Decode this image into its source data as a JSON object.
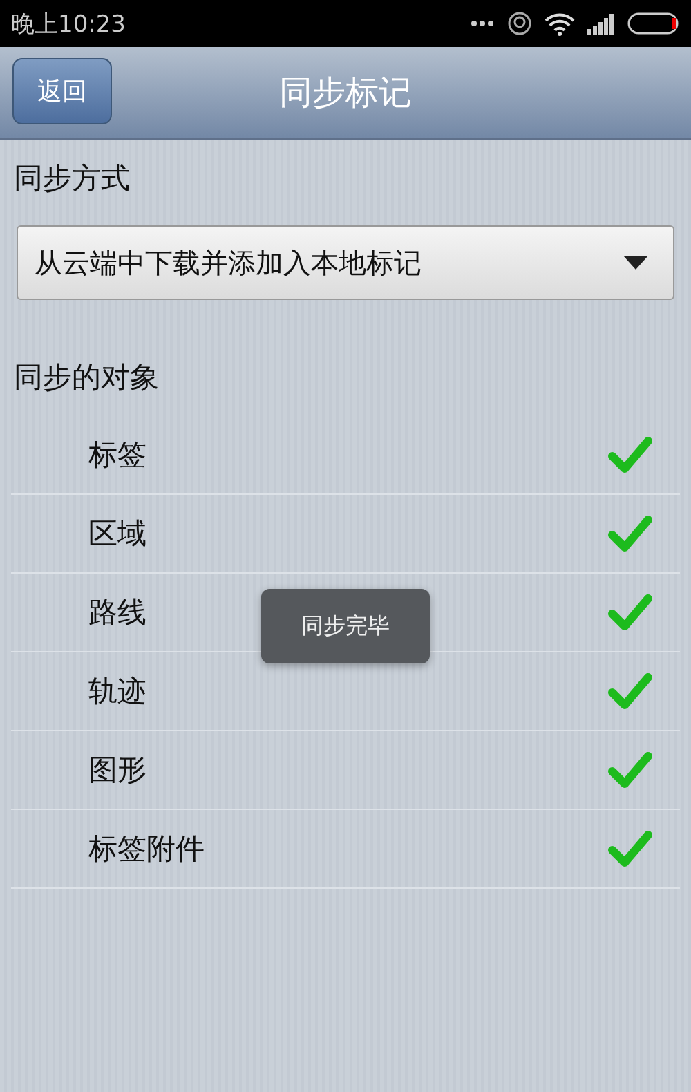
{
  "status_bar": {
    "time": "晚上10:23"
  },
  "header": {
    "back_button": "返回",
    "title": "同步标记"
  },
  "sync_mode": {
    "label": "同步方式",
    "value": "从云端中下载并添加入本地标记"
  },
  "objects": {
    "label": "同步的对象",
    "items": [
      {
        "label": "标签",
        "checked": true
      },
      {
        "label": "区域",
        "checked": true
      },
      {
        "label": "路线",
        "checked": true
      },
      {
        "label": "轨迹",
        "checked": true
      },
      {
        "label": "图形",
        "checked": true
      },
      {
        "label": "标签附件",
        "checked": true
      }
    ]
  },
  "toast": "同步完毕"
}
